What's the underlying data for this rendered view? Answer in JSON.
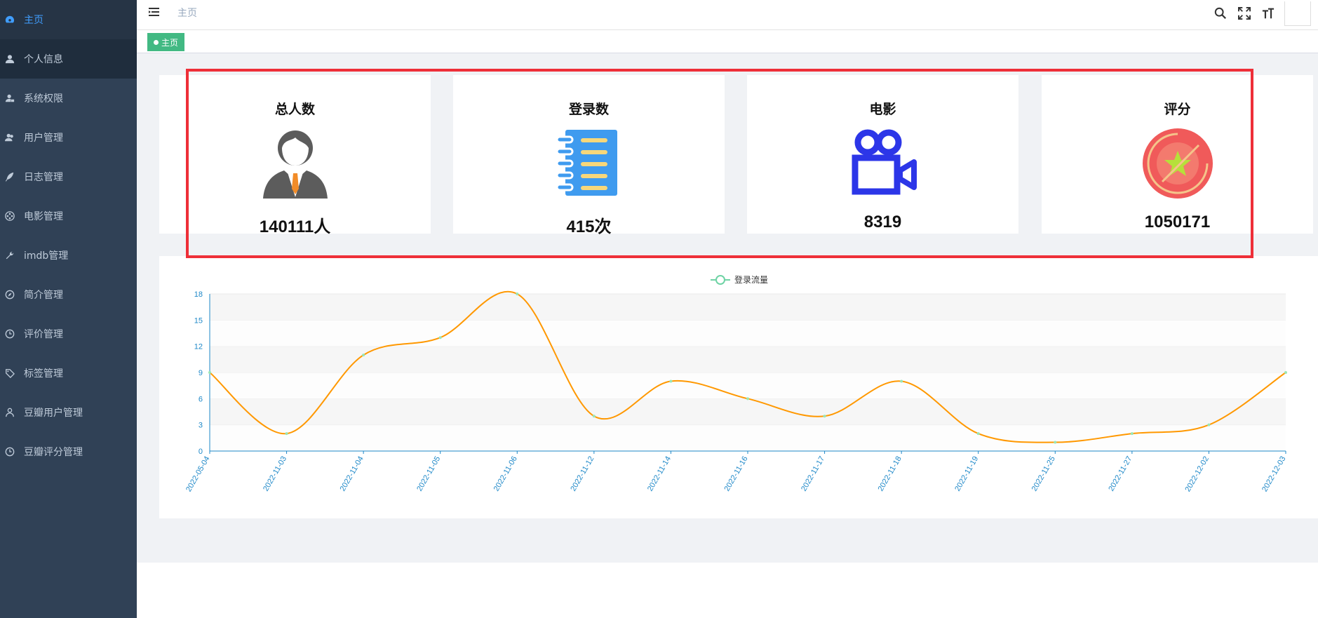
{
  "sidebar": {
    "items": [
      {
        "label": "主页",
        "icon": "dashboard-icon",
        "active": true
      },
      {
        "label": "个人信息",
        "icon": "user-icon"
      },
      {
        "label": "系统权限",
        "icon": "user-lock-icon"
      },
      {
        "label": "用户管理",
        "icon": "users-icon"
      },
      {
        "label": "日志管理",
        "icon": "feather-icon"
      },
      {
        "label": "电影管理",
        "icon": "film-reel-icon"
      },
      {
        "label": "imdb管理",
        "icon": "wrench-icon"
      },
      {
        "label": "简介管理",
        "icon": "compass-icon"
      },
      {
        "label": "评价管理",
        "icon": "clock-icon"
      },
      {
        "label": "标签管理",
        "icon": "tag-icon"
      },
      {
        "label": "豆瓣用户管理",
        "icon": "person-icon"
      },
      {
        "label": "豆瓣评分管理",
        "icon": "clock-icon"
      }
    ]
  },
  "topbar": {
    "breadcrumb": "主页",
    "tools": [
      "search-icon",
      "fullscreen-icon",
      "font-size-icon"
    ]
  },
  "tagsview": {
    "active_tag": "主页"
  },
  "colors": {
    "accent": "#409eff",
    "tag": "#42b983",
    "highlight": "#ee2f38",
    "line": "#ff9800",
    "sidebar": "#304156"
  },
  "cards": [
    {
      "title": "总人数",
      "value": "140111人",
      "icon": "person-suit-icon"
    },
    {
      "title": "登录数",
      "value": "415次",
      "icon": "notebook-icon"
    },
    {
      "title": "电影",
      "value": "8319",
      "icon": "movie-camera-icon"
    },
    {
      "title": "评分",
      "value": "1050171",
      "icon": "star-badge-icon"
    }
  ],
  "chart_data": {
    "type": "line",
    "legend": "登录流量",
    "legend_position": "top-center",
    "categories": [
      "2022-05-04",
      "2022-11-03",
      "2022-11-04",
      "2022-11-05",
      "2022-11-06",
      "2022-11-12",
      "2022-11-14",
      "2022-11-16",
      "2022-11-17",
      "2022-11-18",
      "2022-11-19",
      "2022-11-25",
      "2022-11-27",
      "2022-12-02",
      "2022-12-03"
    ],
    "series": [
      {
        "name": "登录流量",
        "values": [
          9,
          2,
          11,
          13,
          18,
          4,
          8,
          6,
          4,
          8,
          2,
          1,
          2,
          3,
          9
        ]
      }
    ],
    "ylim": [
      0,
      18
    ],
    "yticks": [
      0,
      3,
      6,
      9,
      12,
      15,
      18
    ],
    "smooth": true,
    "grid": "alternating horizontal bands"
  }
}
